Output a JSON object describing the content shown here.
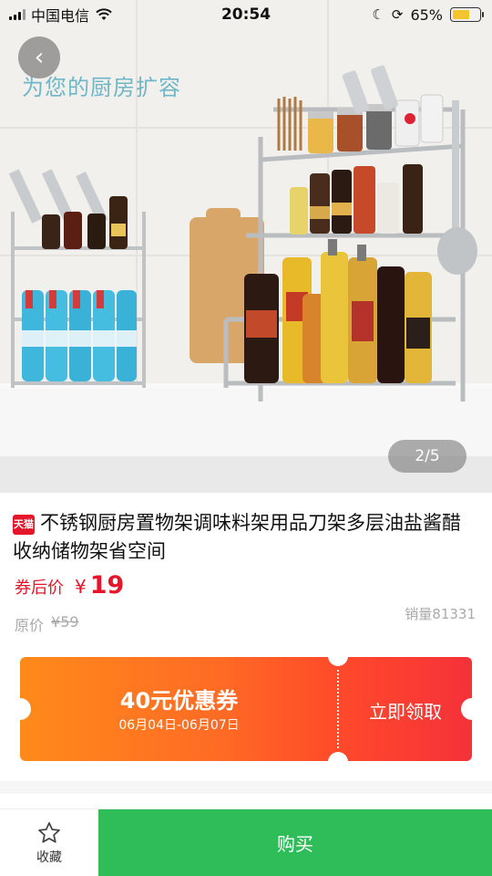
{
  "status_bar": {
    "carrier": "中国电信",
    "time": "20:54",
    "battery": "65%",
    "battery_level": 0.65
  },
  "hero": {
    "caption": "为您的厨房扩容",
    "counter": "2/5"
  },
  "product": {
    "badge": "天猫",
    "title": "不锈钢厨房置物架调味料架用品刀架多层油盐酱醋收纳储物架省空间",
    "price_label": "券后价",
    "currency": "¥",
    "price": "19",
    "original_label": "原价",
    "original_price": "¥59",
    "sales": "销量81331"
  },
  "coupon": {
    "amount": "40元优惠券",
    "validity": "06月04日-06月07日",
    "claim_label": "立即领取"
  },
  "bottom_bar": {
    "favorite_label": "收藏",
    "buy_label": "购买"
  },
  "colors": {
    "price_red": "#e5162b",
    "buy_green": "#2ebd59",
    "coupon_orange": "#ff8a1a",
    "coupon_red": "#f5313a"
  },
  "icons": [
    "back-icon",
    "wifi-icon",
    "moon-icon",
    "orientation-lock-icon",
    "battery-icon",
    "star-icon"
  ]
}
